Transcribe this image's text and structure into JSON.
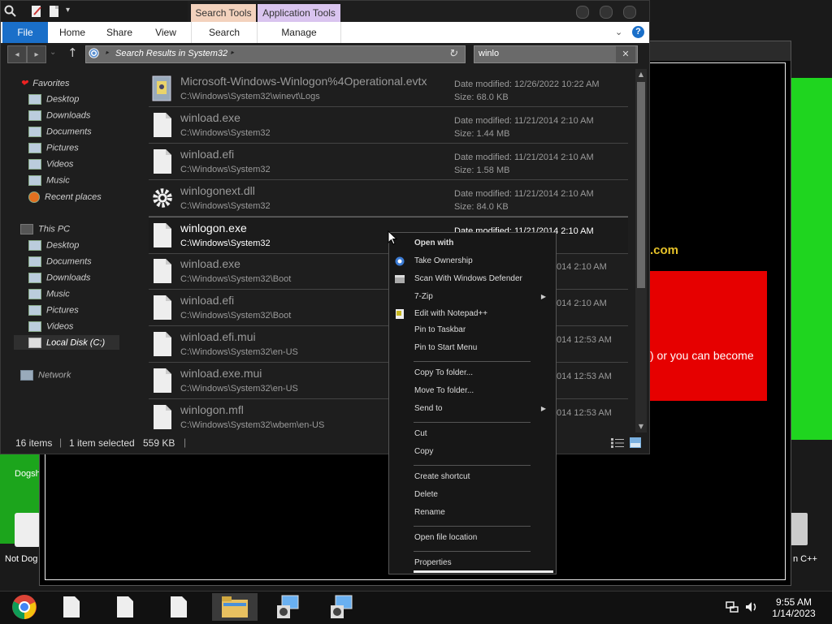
{
  "explorer": {
    "context_tabs": [
      "Search Tools",
      "Application Tools"
    ],
    "ribbon_tabs": [
      "File",
      "Home",
      "Share",
      "View",
      "Search",
      "Manage"
    ],
    "address": "Search Results in System32",
    "search_value": "winlo",
    "nav": {
      "favorites_label": "Favorites",
      "favorites": [
        "Desktop",
        "Downloads",
        "Documents",
        "Pictures",
        "Videos",
        "Music",
        "Recent places"
      ],
      "thispc_label": "This PC",
      "thispc": [
        "Desktop",
        "Documents",
        "Downloads",
        "Music",
        "Pictures",
        "Videos",
        "Local Disk (C:)"
      ],
      "network_label": "Network"
    },
    "files": [
      {
        "name": "Microsoft-Windows-Winlogon%4Operational.evtx",
        "path": "C:\\Windows\\System32\\winevt\\Logs",
        "date": "Date modified: 12/26/2022 10:22 AM",
        "size": "Size: 68.0 KB",
        "icon": "event-log-icon"
      },
      {
        "name": "winload.exe",
        "path": "C:\\Windows\\System32",
        "date": "Date modified: 11/21/2014 2:10 AM",
        "size": "Size: 1.44 MB",
        "icon": "file-icon"
      },
      {
        "name": "winload.efi",
        "path": "C:\\Windows\\System32",
        "date": "Date modified: 11/21/2014 2:10 AM",
        "size": "Size: 1.58 MB",
        "icon": "file-icon"
      },
      {
        "name": "winlogonext.dll",
        "path": "C:\\Windows\\System32",
        "date": "Date modified: 11/21/2014 2:10 AM",
        "size": "Size: 84.0 KB",
        "icon": "gear-icon"
      },
      {
        "name": "winlogon.exe",
        "path": "C:\\Windows\\System32",
        "date": "Date modified: 11/21/2014 2:10 AM",
        "size": "",
        "icon": "file-icon"
      },
      {
        "name": "winload.exe",
        "path": "C:\\Windows\\System32\\Boot",
        "date": "014 2:10 AM",
        "size": "",
        "icon": "file-icon"
      },
      {
        "name": "winload.efi",
        "path": "C:\\Windows\\System32\\Boot",
        "date": "014 2:10 AM",
        "size": "",
        "icon": "file-icon"
      },
      {
        "name": "winload.efi.mui",
        "path": "C:\\Windows\\System32\\en-US",
        "date": "014 12:53 AM",
        "size": "",
        "icon": "file-icon"
      },
      {
        "name": "winload.exe.mui",
        "path": "C:\\Windows\\System32\\en-US",
        "date": "014 12:53 AM",
        "size": "",
        "icon": "file-icon"
      },
      {
        "name": "winlogon.mfl",
        "path": "C:\\Windows\\System32\\wbem\\en-US",
        "date": "014 12:53 AM",
        "size": "",
        "icon": "file-icon"
      }
    ],
    "status": {
      "items": "16 items",
      "selected": "1 item selected",
      "size": "559 KB"
    }
  },
  "context_menu": {
    "items": [
      {
        "label": "Open with",
        "bold": true
      },
      {
        "label": "Take Ownership",
        "icon": "gear-icon"
      },
      {
        "label": "Scan With Windows Defender",
        "icon": "defender-icon"
      },
      {
        "label": "7-Zip",
        "submenu": true
      },
      {
        "label": "Edit with Notepad++",
        "icon": "notepad-icon"
      },
      {
        "label": "Pin to Taskbar"
      },
      {
        "label": "Pin to Start Menu"
      },
      {
        "label": "Copy To folder..."
      },
      {
        "label": "Move To folder..."
      },
      {
        "label": "Send to",
        "submenu": true
      },
      {
        "label": "Cut"
      },
      {
        "label": "Copy"
      },
      {
        "label": "Create shortcut"
      },
      {
        "label": "Delete"
      },
      {
        "label": "Rename"
      },
      {
        "label": "Open file location"
      },
      {
        "label": "Properties"
      }
    ]
  },
  "background": {
    "yellow_text": ".com",
    "red_text": ") or you can become",
    "desktop_left": [
      "Dogsh",
      "Not Dog"
    ],
    "desktop_right": "n C++"
  },
  "taskbar": {
    "time": "9:55 AM",
    "date": "1/14/2023"
  }
}
